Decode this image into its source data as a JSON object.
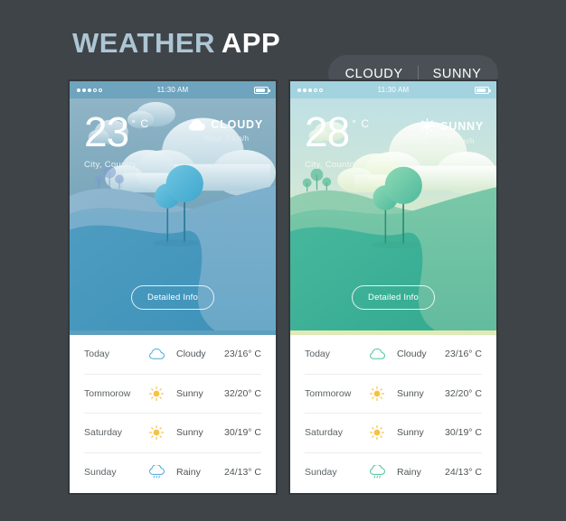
{
  "header": {
    "title_part1": "WEATHER",
    "title_part2": "APP",
    "toggle": {
      "option_left": "CLOUDY",
      "option_right": "SUNNY",
      "separator": "|"
    }
  },
  "colors": {
    "page_background": "#3f4448",
    "title_accent": "#adc6d4",
    "title_white": "#ffffff",
    "toggle_background": "#4a5055",
    "cloudy_statusbar": "#6ea4bd",
    "sunny_statusbar": "#a4d3e0",
    "cloudy_icon": "#4aa8d8",
    "sunny_icon": "#f5c242",
    "green_icon": "#49c39a",
    "list_text": "#4f5457",
    "divider": "#ececec"
  },
  "phones": [
    {
      "theme": "cloudy",
      "status": {
        "signal_filled": 3,
        "signal_empty": 2,
        "time": "11:30 AM",
        "battery_level": "80"
      },
      "current": {
        "temperature": "23",
        "degree_symbol": "°",
        "unit": "C",
        "location": "City, Country",
        "condition": "CLOUDY",
        "condition_icon": "cloud-icon",
        "wind_label": "Wind",
        "wind_value": "3 km/h"
      },
      "detail_button": "Detailed Info",
      "forecast": [
        {
          "day": "Today",
          "icon": "cloud-icon",
          "condition": "Cloudy",
          "temps": "23/16",
          "unit": "° C"
        },
        {
          "day": "Tommorow",
          "icon": "sun-icon",
          "condition": "Sunny",
          "temps": "32/20",
          "unit": "° C"
        },
        {
          "day": "Saturday",
          "icon": "sun-icon",
          "condition": "Sunny",
          "temps": "30/19",
          "unit": "° C"
        },
        {
          "day": "Sunday",
          "icon": "rain-icon",
          "condition": "Rainy",
          "temps": "24/13",
          "unit": "° C"
        }
      ]
    },
    {
      "theme": "sunny",
      "status": {
        "signal_filled": 3,
        "signal_empty": 2,
        "time": "11:30 AM",
        "battery_level": "80"
      },
      "current": {
        "temperature": "28",
        "degree_symbol": "°",
        "unit": "C",
        "location": "City, Country",
        "condition": "SUNNY",
        "condition_icon": "sun-icon",
        "wind_label": "Wind",
        "wind_value": "3 km/h"
      },
      "detail_button": "Detailed Info",
      "forecast": [
        {
          "day": "Today",
          "icon": "cloud-icon",
          "condition": "Cloudy",
          "temps": "23/16",
          "unit": "° C"
        },
        {
          "day": "Tommorow",
          "icon": "sun-icon",
          "condition": "Sunny",
          "temps": "32/20",
          "unit": "° C"
        },
        {
          "day": "Saturday",
          "icon": "sun-icon",
          "condition": "Sunny",
          "temps": "30/19",
          "unit": "° C"
        },
        {
          "day": "Sunday",
          "icon": "rain-icon",
          "condition": "Rainy",
          "temps": "24/13",
          "unit": "° C"
        }
      ]
    }
  ]
}
